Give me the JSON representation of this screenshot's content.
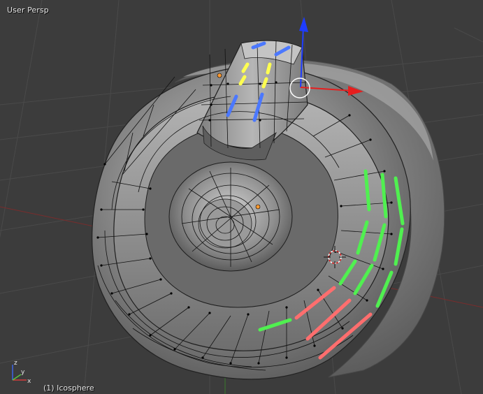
{
  "viewport": {
    "view_label": "User Persp",
    "object_label": "(1) Icosphere",
    "background_color": "#3c3c3c",
    "grid_color": "#4a4a4a"
  },
  "axis_widget": {
    "x_letter": "x",
    "y_letter": "y",
    "z_letter": "z",
    "x_color": "#d23c3c",
    "y_color": "#5ac83c",
    "z_color": "#3c64e6"
  },
  "manipulator": {
    "z_color": "#1e3cff",
    "x_color": "#e61e1e",
    "ring_color": "#ffffff"
  },
  "seams": {
    "blue": "#4b78ff",
    "yellow": "#ffff50",
    "green": "#50f050",
    "red": "#ff6e6e"
  },
  "mesh": {
    "name": "Icosphere",
    "base_color": "#8a8a8a"
  }
}
